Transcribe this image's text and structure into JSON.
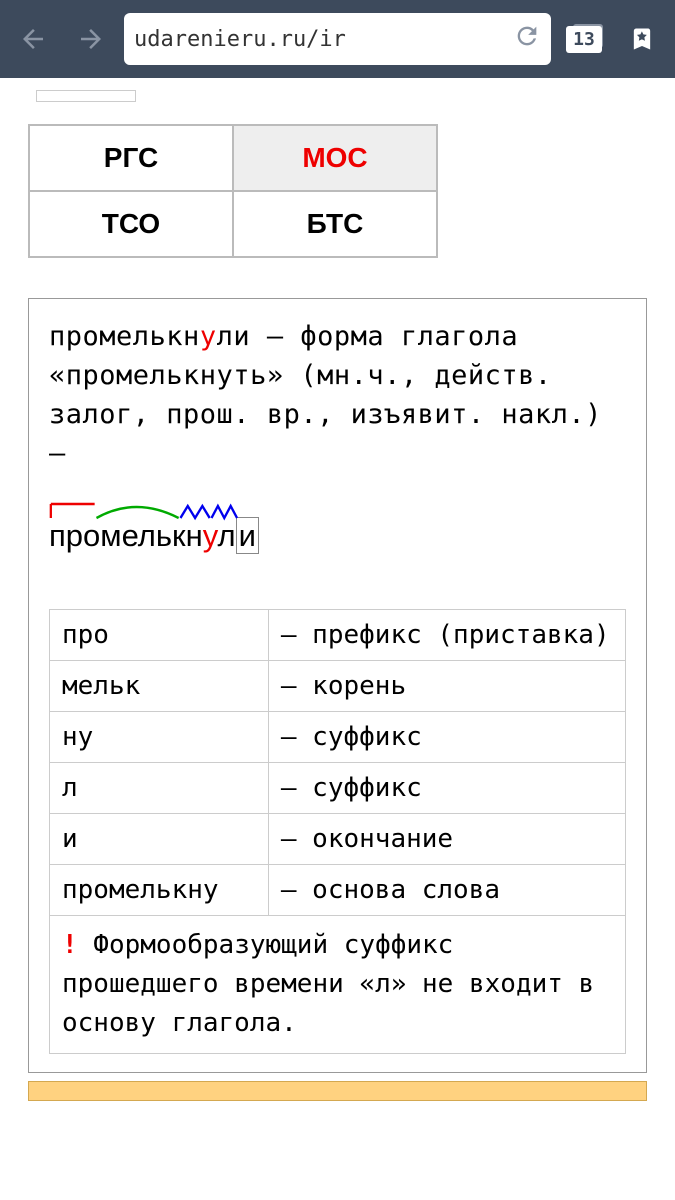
{
  "browser": {
    "url": "udarenieru.ru/ir",
    "tab_count": "13"
  },
  "tabs": {
    "rgs": "РГС",
    "mos": "МОС",
    "tso": "ТСО",
    "bts": "БТС"
  },
  "description": {
    "word_pre": "промелькн",
    "word_stress": "у",
    "word_post": "ли",
    "rest": " — форма глагола «промелькнуть» (мн.ч., действ. залог, прош. вр., изъявит. накл.) —"
  },
  "morph_word": {
    "p1": "промелькн",
    "stress": "у",
    "p2": "л",
    "ending": "и"
  },
  "morph_table": [
    {
      "part": "про",
      "desc": "— префикс (приставка)"
    },
    {
      "part": "мельк",
      "desc": "— корень"
    },
    {
      "part": "ну",
      "desc": "— суффикс"
    },
    {
      "part": "л",
      "desc": "— суффикс"
    },
    {
      "part": "и",
      "desc": "— окончание"
    },
    {
      "part": "промелькну",
      "desc": "— основа слова"
    }
  ],
  "note": {
    "bang": "!",
    "text": " Формообразующий суффикс прошедшего времени «л» не входит в основу глагола."
  }
}
